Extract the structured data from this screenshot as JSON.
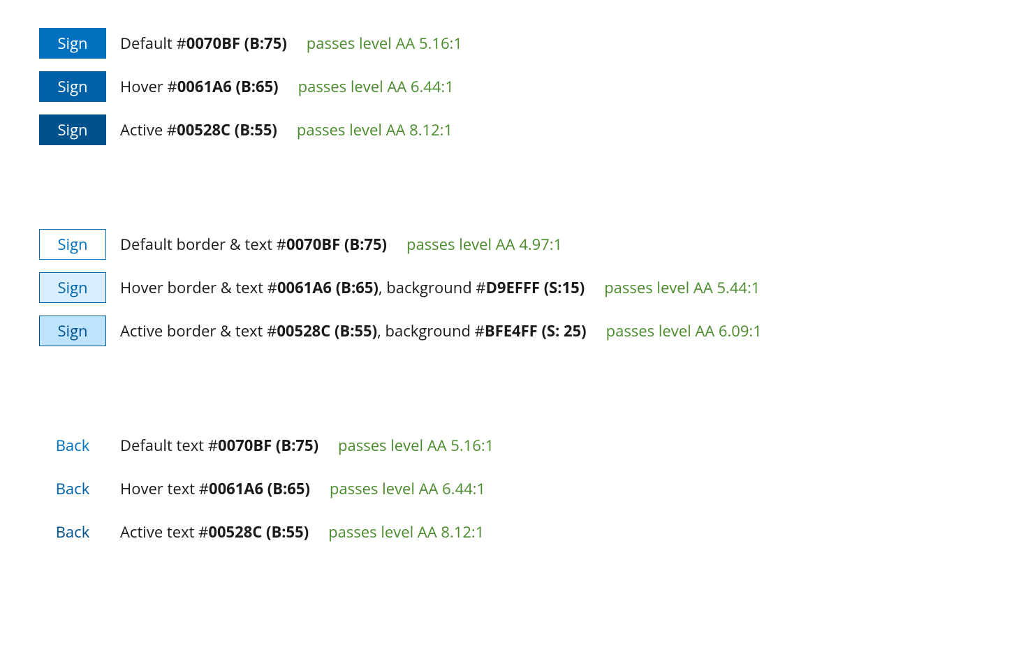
{
  "groups": [
    {
      "type": "solid",
      "label": "Sign",
      "rows": [
        {
          "state": "default",
          "desc_prefix": "Default #",
          "desc_bold": "0070BF (B:75)",
          "desc_suffix": "",
          "pass": "passes level AA 5.16:1"
        },
        {
          "state": "hover",
          "desc_prefix": "Hover #",
          "desc_bold": "0061A6 (B:65)",
          "desc_suffix": "",
          "pass": "passes level AA 6.44:1"
        },
        {
          "state": "active",
          "desc_prefix": "Active #",
          "desc_bold": "00528C (B:55)",
          "desc_suffix": "",
          "pass": "passes level AA 8.12:1"
        }
      ]
    },
    {
      "type": "outline",
      "label": "Sign",
      "rows": [
        {
          "state": "default",
          "desc_prefix": "Default border & text #",
          "desc_bold": "0070BF (B:75)",
          "desc_suffix": "",
          "pass": "passes level AA 4.97:1"
        },
        {
          "state": "hover",
          "desc_prefix": "Hover border & text #",
          "desc_bold": "0061A6 (B:65)",
          "desc_suffix": ", background #",
          "desc_bold2": "D9EFFF (S:15)",
          "pass": "passes level AA 5.44:1"
        },
        {
          "state": "active",
          "desc_prefix": "Active border & text #",
          "desc_bold": "00528C (B:55)",
          "desc_suffix": ", background #",
          "desc_bold2": "BFE4FF (S: 25)",
          "pass": "passes level AA 6.09:1"
        }
      ]
    },
    {
      "type": "text",
      "label": "Back",
      "rows": [
        {
          "state": "default",
          "desc_prefix": "Default text #",
          "desc_bold": "0070BF (B:75)",
          "desc_suffix": "",
          "pass": "passes level AA 5.16:1"
        },
        {
          "state": "hover",
          "desc_prefix": "Hover text #",
          "desc_bold": "0061A6 (B:65)",
          "desc_suffix": "",
          "pass": "passes level AA 6.44:1"
        },
        {
          "state": "active",
          "desc_prefix": "Active text #",
          "desc_bold": "00528C (B:55)",
          "desc_suffix": "",
          "pass": "passes level AA 8.12:1"
        }
      ]
    }
  ]
}
